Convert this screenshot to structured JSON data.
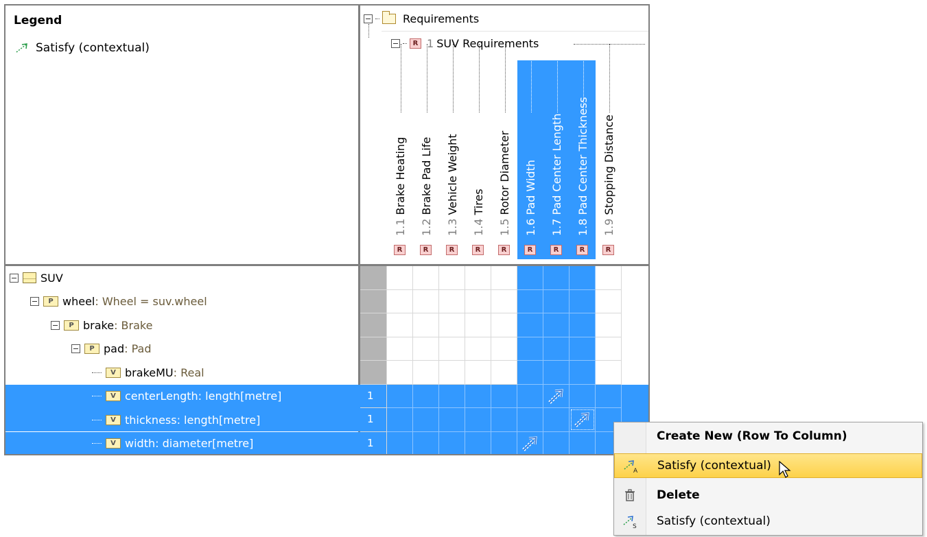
{
  "legend": {
    "title": "Legend",
    "item_label": "Satisfy (contextual)"
  },
  "header": {
    "root": "Requirements",
    "group_num": "1",
    "group_name": "SUV Requirements",
    "chip_letter": "R"
  },
  "columns": [
    {
      "num": "1.1",
      "name": "Brake Heating",
      "selected": false
    },
    {
      "num": "1.2",
      "name": "Brake Pad Life",
      "selected": false
    },
    {
      "num": "1.3",
      "name": "Vehicle Weight",
      "selected": false
    },
    {
      "num": "1.4",
      "name": "Tires",
      "selected": false
    },
    {
      "num": "1.5",
      "name": "Rotor Diameter",
      "selected": false
    },
    {
      "num": "1.6",
      "name": "Pad Width",
      "selected": true
    },
    {
      "num": "1.7",
      "name": "Pad Center Length",
      "selected": true
    },
    {
      "num": "1.8",
      "name": "Pad Center Thickness",
      "selected": true
    },
    {
      "num": "1.9",
      "name": "Stopping Distance",
      "selected": false
    }
  ],
  "rows": [
    {
      "name": "SUV",
      "type": "",
      "icon": "block",
      "count": "",
      "selected": false
    },
    {
      "name": "wheel",
      "type": " : Wheel = suv.wheel",
      "icon": "P",
      "count": "",
      "selected": false
    },
    {
      "name": "brake",
      "type": " : Brake",
      "icon": "P",
      "count": "",
      "selected": false
    },
    {
      "name": "pad",
      "type": " : Pad",
      "icon": "P",
      "count": "",
      "selected": false
    },
    {
      "name": "brakeMU",
      "type": " : Real",
      "icon": "V",
      "count": "",
      "selected": false
    },
    {
      "name": "centerLength",
      "type": " : length[metre]",
      "icon": "V",
      "count": "1",
      "selected": true
    },
    {
      "name": "thickness",
      "type": " : length[metre]",
      "icon": "V",
      "count": "1",
      "selected": true
    },
    {
      "name": "width",
      "type": " : diameter[metre]",
      "icon": "V",
      "count": "1",
      "selected": true
    }
  ],
  "context_menu": {
    "header": "Create New (Row To Column)",
    "item1": "Satisfy (contextual)",
    "item1_icon_letter": "A",
    "delete": "Delete",
    "item2": "Satisfy (contextual)",
    "item2_icon_letter": "S"
  },
  "colors": {
    "selection": "#3399ff",
    "highlight": "#fdd24a"
  }
}
